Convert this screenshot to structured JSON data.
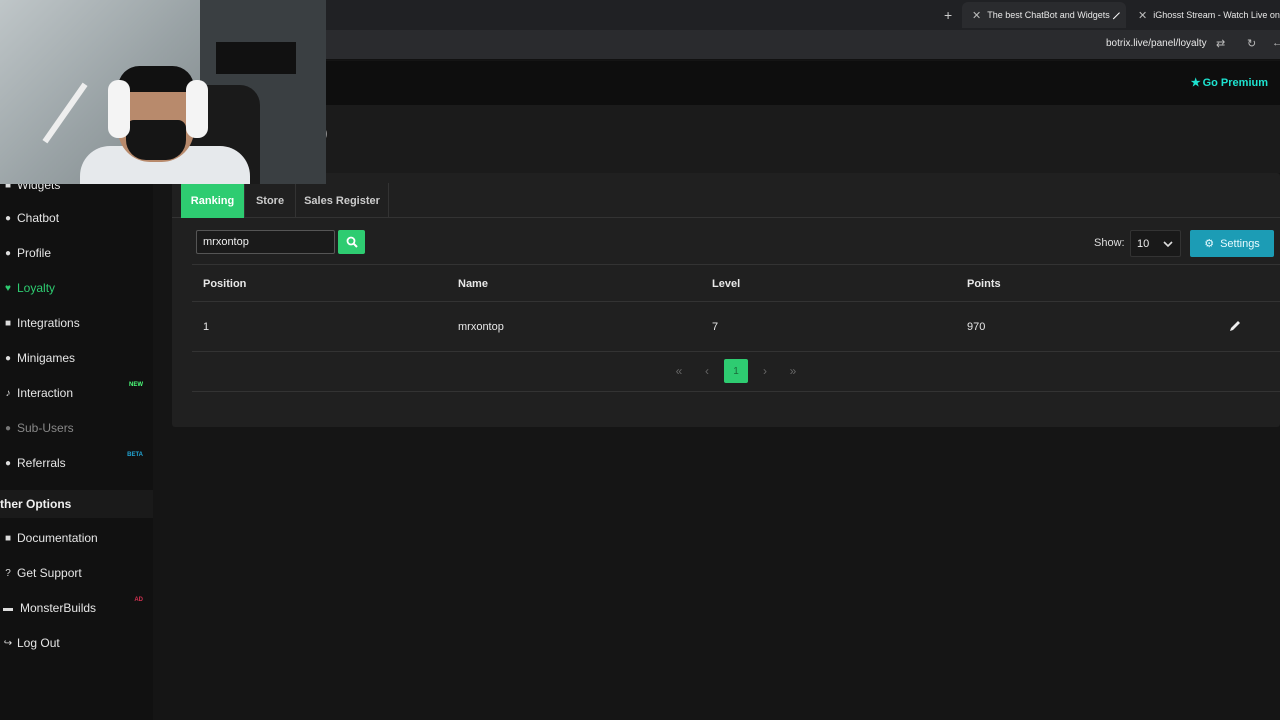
{
  "browser": {
    "tabs": [
      {
        "title": "The best ChatBot and Widgets",
        "active": true
      },
      {
        "title": "iGhosst Stream - Watch Live on",
        "active": false
      }
    ],
    "url": "botrix.live/panel/loyalty"
  },
  "header": {
    "premium_label": "Go Premium"
  },
  "page": {
    "title_fragment": ")"
  },
  "sidebar": {
    "items": [
      {
        "label": "Widgets",
        "icon": "widgets-icon"
      },
      {
        "label": "Chatbot",
        "icon": "chatbot-icon"
      },
      {
        "label": "Profile",
        "icon": "profile-icon"
      },
      {
        "label": "Loyalty",
        "icon": "loyalty-icon",
        "active": true
      },
      {
        "label": "Integrations",
        "icon": "integrations-icon"
      },
      {
        "label": "Minigames",
        "icon": "minigames-icon"
      },
      {
        "label": "Interaction",
        "icon": "interaction-icon",
        "badge": "NEW"
      },
      {
        "label": "Sub-Users",
        "icon": "sub-users-icon",
        "disabled": true
      },
      {
        "label": "Referrals",
        "icon": "referrals-icon",
        "badge": "BETA"
      }
    ],
    "other_header": "ther Options",
    "other_items": [
      {
        "label": "Documentation",
        "icon": "documentation-icon"
      },
      {
        "label": "Get Support",
        "icon": "support-icon"
      },
      {
        "label": "MonsterBuilds",
        "icon": "monsterbuilds-icon",
        "badge": "AD"
      },
      {
        "label": "Log Out",
        "icon": "logout-icon"
      }
    ]
  },
  "tabs": [
    {
      "label": "Ranking",
      "active": true
    },
    {
      "label": "Store"
    },
    {
      "label": "Sales Register"
    }
  ],
  "search": {
    "value": "mrxontop"
  },
  "show": {
    "label": "Show:",
    "value": "10"
  },
  "settings_button": "Settings",
  "table": {
    "headers": [
      "Position",
      "Name",
      "Level",
      "Points"
    ],
    "rows": [
      {
        "position": "1",
        "name": "mrxontop",
        "level": "7",
        "points": "970"
      }
    ]
  },
  "pagination": {
    "current": "1"
  },
  "colors": {
    "accent": "#2ecc71",
    "premium": "#1ee3d0",
    "settings": "#1c9cb5",
    "new_badge": "#4cff7a",
    "beta_badge": "#22a6d6",
    "ad_badge": "#d13050"
  }
}
